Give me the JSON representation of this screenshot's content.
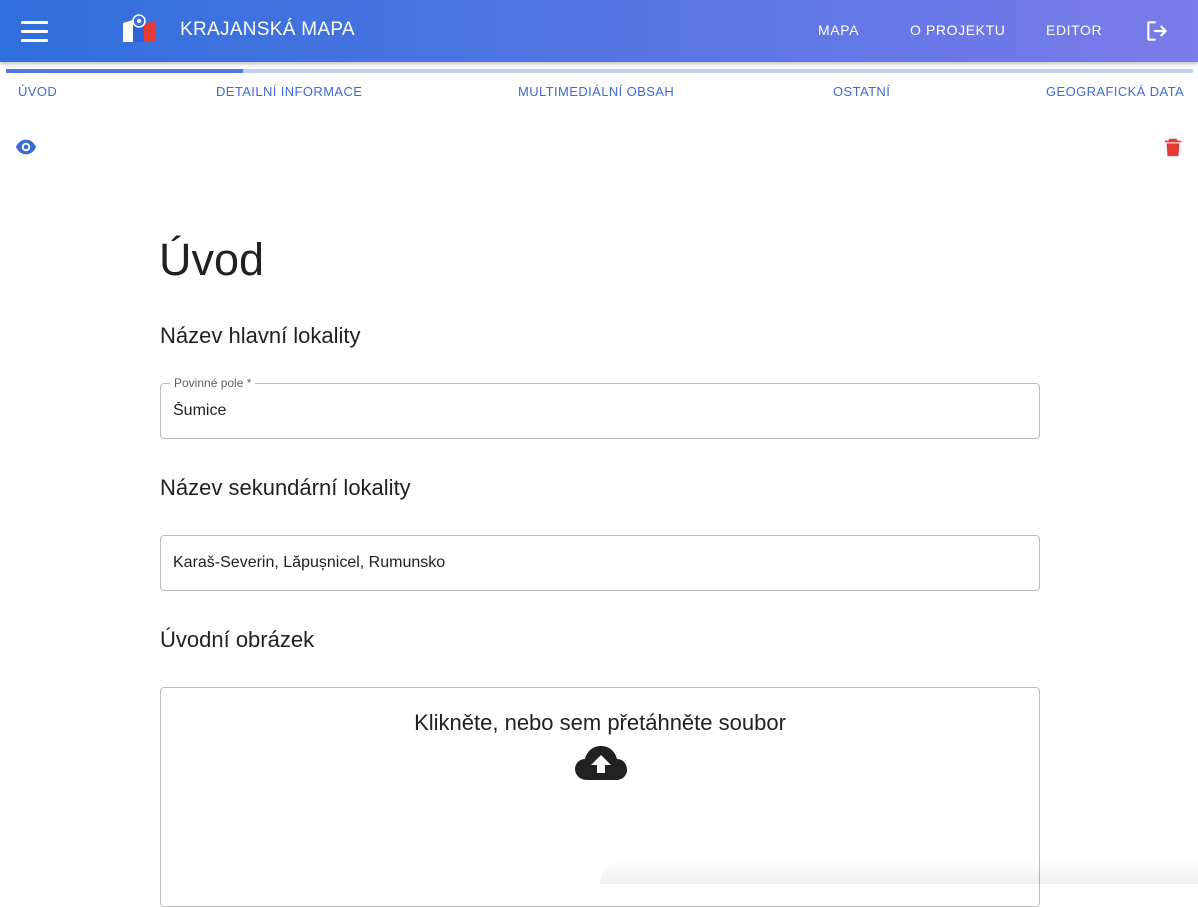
{
  "appbar": {
    "title": "KRAJANSKÁ MAPA",
    "nav": [
      "MAPA",
      "O PROJEKTU",
      "EDITOR"
    ],
    "logo_colors": [
      "#ffffff",
      "#2f62d6",
      "#e53935"
    ]
  },
  "tabs": {
    "items": [
      "ÚVOD",
      "DETAILNÍ INFORMACE",
      "MULTIMEDIÁLNÍ OBSAH",
      "OSTATNÍ",
      "GEOGRAFICKÁ DATA"
    ],
    "active": "ÚVOD"
  },
  "actions": {
    "preview_icon": "eye-icon",
    "delete_icon": "trash-icon",
    "delete_color": "#e53935",
    "preview_color": "#3d6ad6"
  },
  "main": {
    "page_title": "Úvod",
    "primary": {
      "section_title": "Název hlavní lokality",
      "label": "Povinné pole *",
      "value": "Šumice"
    },
    "secondary": {
      "section_title": "Název sekundární lokality",
      "value": "Karaš-Severin, Lăpușnicel, Rumunsko"
    },
    "image": {
      "section_title": "Úvodní obrázek",
      "dropzone_text": "Klikněte, nebo sem přetáhněte soubor",
      "icon": "cloud-upload-icon"
    }
  }
}
